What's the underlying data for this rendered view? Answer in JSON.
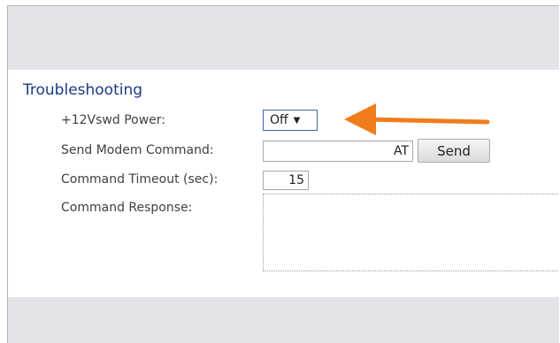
{
  "section": {
    "title": "Troubleshooting"
  },
  "fields": {
    "power": {
      "label": "+12Vswd Power:",
      "selected": "Off",
      "arrow_glyph": "▼"
    },
    "modem_command": {
      "label": "Send Modem Command:",
      "value": "AT",
      "button_label": "Send"
    },
    "timeout": {
      "label": "Command Timeout (sec):",
      "value": "15"
    },
    "response": {
      "label": "Command Response:",
      "value": ""
    }
  },
  "annotation": {
    "arrow_color": "#f07c1b",
    "icon": "left-arrow-icon"
  },
  "colors": {
    "band": "#e2e4e7",
    "title": "#1a3a82",
    "select_border": "#3e63a8"
  }
}
